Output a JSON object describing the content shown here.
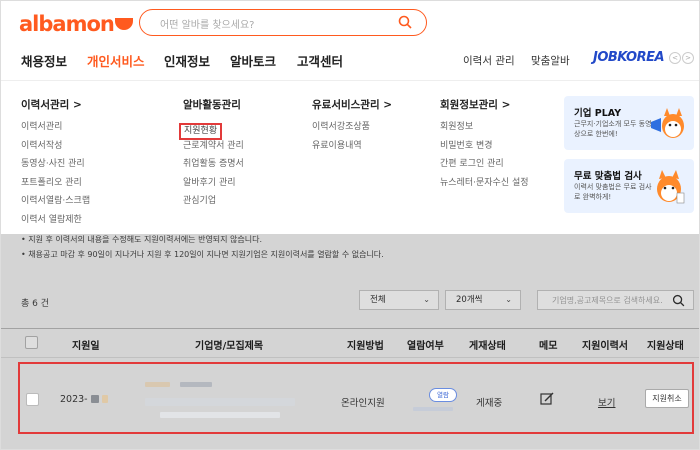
{
  "header": {
    "logo": "albamon",
    "search_placeholder": "어떤 알바를 찾으세요?"
  },
  "gnb": {
    "items": [
      "채용정보",
      "개인서비스",
      "인재정보",
      "알바토크",
      "고객센터"
    ],
    "active": "개인서비스",
    "right_links": [
      "이력서 관리",
      "맞춤알바"
    ],
    "partner": "JOBKOREA"
  },
  "mega_menu": {
    "columns": [
      {
        "title": "이력서관리 >",
        "items": [
          "이력서관리",
          "이력서작성",
          "동영상·사진 관리",
          "포트폴리오 관리",
          "이력서열람·스크랩",
          "이력서 열람제한"
        ]
      },
      {
        "title": "알바활동관리",
        "items": [
          "지원현황",
          "근로계약서 관리",
          "취업활동 증명서",
          "알바후기 관리",
          "관심기업"
        ]
      },
      {
        "title": "유료서비스관리 >",
        "items": [
          "이력서강조상품",
          "유료이용내역"
        ]
      },
      {
        "title": "회원정보관리 >",
        "items": [
          "회원정보",
          "비밀번호 변경",
          "간편 로그인 관리",
          "뉴스레터·문자수신 설정"
        ]
      }
    ],
    "highlighted_item": "지원현황",
    "promos": [
      {
        "title": "기업 PLAY",
        "desc": "근무지·기업소개 모두 동영상으로 한번에!"
      },
      {
        "title": "무료 맞춤법 검사",
        "desc": "이력서 맞춤법은 무료 검사로 완벽하게!"
      }
    ]
  },
  "page": {
    "notice_1": "• 지원 후 이력서의 내용을 수정해도 지원이력서에는 반영되지 않습니다.",
    "notice_2": "• 채용공고 마감 후 90일이 지나거나 지원 후 120일이 지나면 지원기업은 지원이력서를 열람할 수 없습니다.",
    "total": "총 6 건",
    "filter_all": "전체",
    "filter_count": "20개씩",
    "filter_placeholder": "기업명,공고제목으로 검색하세요.",
    "columns": [
      "지원일",
      "기업명/모집제목",
      "지원방법",
      "열람여부",
      "게재상태",
      "메모",
      "지원이력서",
      "지원상태"
    ],
    "row": {
      "date": "2023-",
      "method": "온라인지원",
      "read": "열람",
      "status": "게재중",
      "resume_link": "보기",
      "cancel": "지원취소"
    }
  }
}
